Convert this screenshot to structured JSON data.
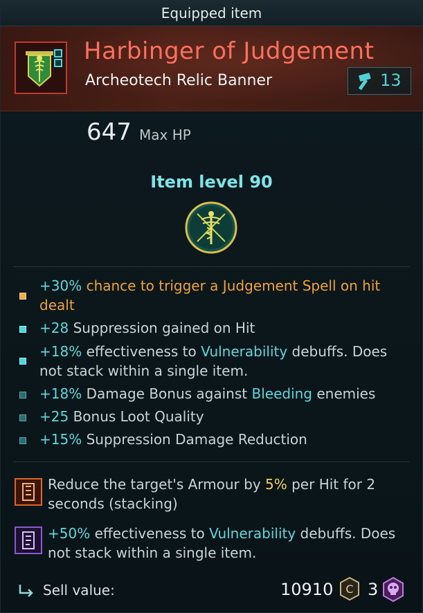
{
  "header": {
    "title": "Equipped item"
  },
  "item": {
    "name": "Harbinger of Judgement",
    "type": "Archeotech Relic Banner",
    "power": "13",
    "icon": "banner-icon"
  },
  "stat": {
    "value": "647",
    "label": "Max HP"
  },
  "item_level": "Item level 90",
  "affixes": [
    {
      "val": "+30%",
      "text1": " chance to trigger a ",
      "kw": "Judgement Spell",
      "text2": " on hit dealt"
    },
    {
      "val": "+28",
      "text1": " Suppression gained on Hit"
    },
    {
      "val": "+18%",
      "text1": " effectiveness to ",
      "kw": "Vulnerability",
      "text2": " debuffs. Does not stack within a single item."
    },
    {
      "val": "+18%",
      "text1": " Damage Bonus against ",
      "kw": "Bleeding",
      "text2": " enemies"
    },
    {
      "val": "+25",
      "text1": " Bonus Loot Quality"
    },
    {
      "val": "+15%",
      "text1": " Suppression Damage Reduction"
    }
  ],
  "runes": [
    {
      "text1": "Reduce the target's Armour by ",
      "val": "5%",
      "text2": " per Hit for 2 seconds (stacking)"
    },
    {
      "val": "+50%",
      "text1": " effectiveness to ",
      "kw": "Vulnerability",
      "text2": " debuffs. Does not stack within a single item."
    }
  ],
  "footer": {
    "label": "Sell value:",
    "amount": "10910",
    "skull_count": "3"
  },
  "colors": {
    "name": "#ff6f5f",
    "accent": "#5ed8dc",
    "orange": "#f0a23c",
    "yellow": "#f2d35a"
  }
}
